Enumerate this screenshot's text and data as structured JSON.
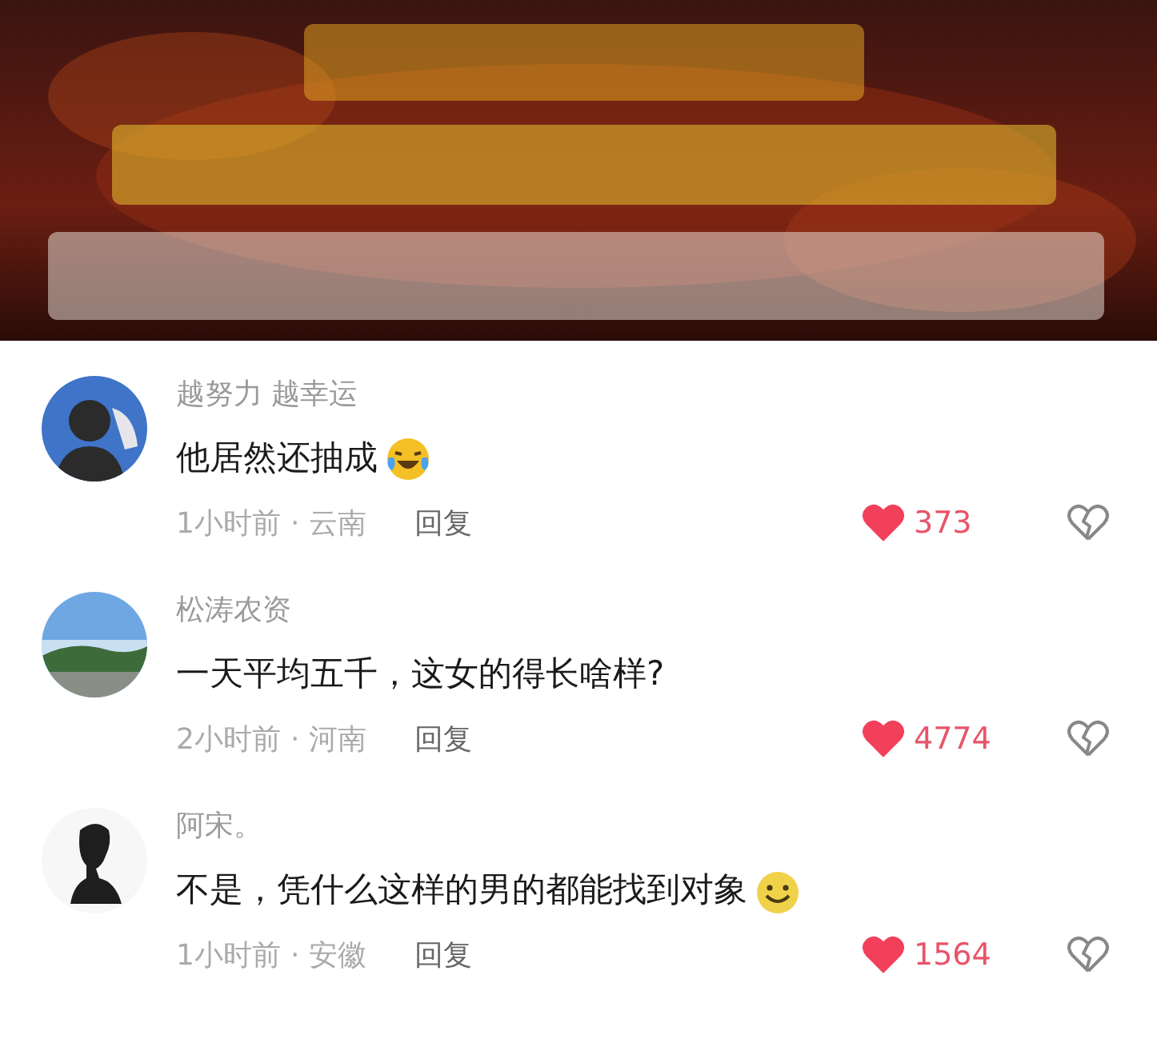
{
  "comments": [
    {
      "avatar": {
        "kind": "silhouette"
      },
      "username": "越努力 越幸运",
      "text": "他居然还抽成",
      "emoji": {
        "kind": "laughing"
      },
      "time": "1小时前",
      "separator": "·",
      "location": "云南",
      "reply": "回复",
      "likes": "373",
      "liked": true
    },
    {
      "username": "松涛农资",
      "text": "一天平均五千，这女的得长啥样?",
      "time": "2小时前",
      "separator": "·",
      "location": "河南",
      "reply": "回复",
      "likes": "4774",
      "liked": true
    },
    {
      "avatar": {
        "kind": "sketch"
      },
      "username": "阿宋。",
      "text": "不是，凭什么这样的男的都能找到对象",
      "emoji": {
        "kind": "smile"
      },
      "time": "1小时前",
      "separator": "·",
      "location": "安徽",
      "reply": "回复",
      "likes": "1564",
      "liked": true
    }
  ]
}
